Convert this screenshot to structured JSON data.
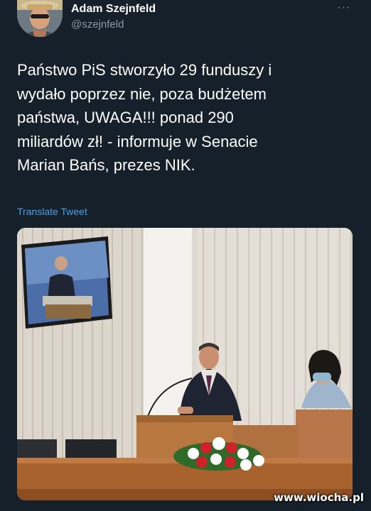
{
  "tweet": {
    "author": {
      "display_name": "Adam Szejnfeld",
      "handle": "@szejnfeld"
    },
    "more_label": "···",
    "text": "Państwo PiS stworzyło 29 funduszy i\nwydało poprzez nie,  poza budżetem\npaństwa, UWAGA!!! ponad 290\nmiliardów zł! - informuje w Senacie\nMarian Bańs, prezes NIK.",
    "translate_label": "Translate Tweet"
  },
  "watermark": "www.wiocha.pl",
  "colors": {
    "background": "#15202b",
    "text": "#ffffff",
    "secondary": "#8b98a5",
    "link": "#4d9fe8"
  },
  "icons": {
    "more": "more-horizontal-icon"
  }
}
